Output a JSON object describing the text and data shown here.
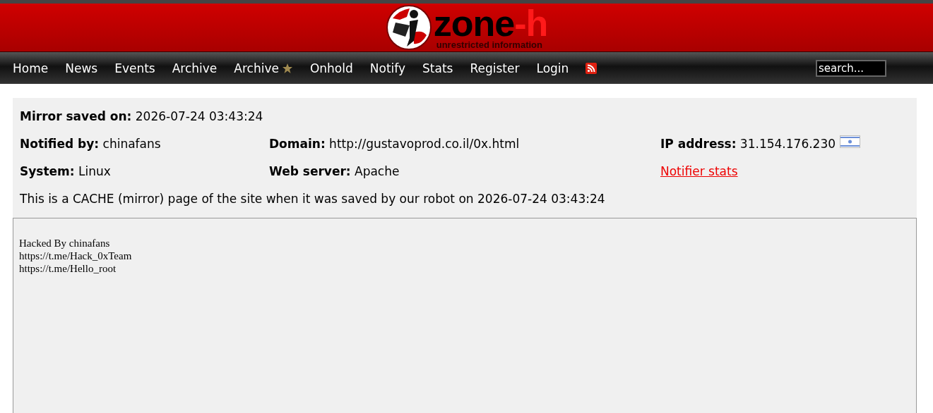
{
  "logo": {
    "name": "zone",
    "suffix": "-h",
    "tagline": "unrestricted information"
  },
  "nav": {
    "items": [
      {
        "label": "Home",
        "kind": "link"
      },
      {
        "label": "News",
        "kind": "link"
      },
      {
        "label": "Events",
        "kind": "link"
      },
      {
        "label": "Archive",
        "kind": "link"
      },
      {
        "label": "Archive",
        "kind": "starred"
      },
      {
        "label": "Onhold",
        "kind": "link"
      },
      {
        "label": "Notify",
        "kind": "link"
      },
      {
        "label": "Stats",
        "kind": "link"
      },
      {
        "label": "Register",
        "kind": "link"
      },
      {
        "label": "Login",
        "kind": "link"
      },
      {
        "kind": "rss"
      }
    ],
    "search": {
      "value": "search..."
    }
  },
  "mirror_info": {
    "saved_on": "**Mirror saved on:** 2026-07-24 03:43:24",
    "rows": [
      [
        "**Notified by:** chinafans",
        "**Domain:** http://gustavoprod.co.il/0x.html",
        "**IP address:** 31.154.176.230"
      ],
      [
        "**System:** Linux",
        "**Web server:** Apache",
        "Notifier stats"
      ]
    ],
    "note": "This is a CACHE (mirror) page of the site when it was saved by our robot on 2026-07-24 03:43:24"
  },
  "mirror_frame": {
    "lines": [
      "Hacked By chinafans",
      "https://t.me/Hack_0xTeam",
      "https://t.me/Hello_root"
    ]
  }
}
